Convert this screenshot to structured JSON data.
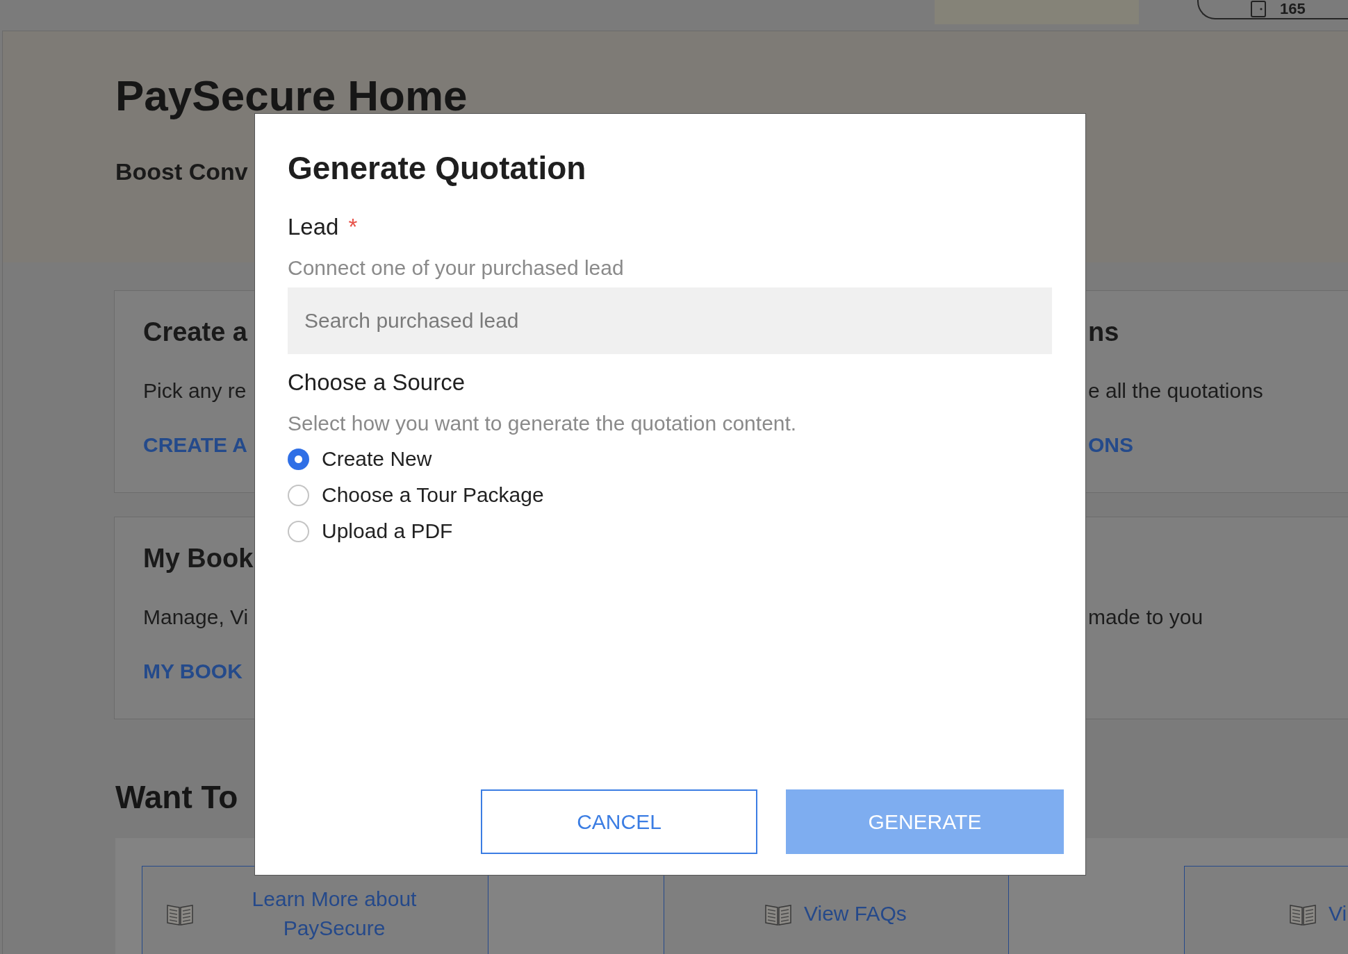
{
  "top_bar": {
    "count": "165"
  },
  "page": {
    "title": "PaySecure Home",
    "subtitle": "Boost Conv"
  },
  "card_rows": [
    {
      "cards": [
        {
          "title": "Create a",
          "text": "Pick any re",
          "link": "CREATE A"
        },
        {
          "title": "ns",
          "text": "e all the quotations",
          "link": "ONS"
        }
      ]
    },
    {
      "cards": [
        {
          "title": "My Book",
          "text": "Manage, Vi",
          "link": "MY BOOK"
        },
        {
          "text": "made to you"
        }
      ]
    }
  ],
  "section_title": "Want To",
  "resources": [
    {
      "label": "Learn More about PaySecure"
    },
    {
      "label": "View FAQs"
    },
    {
      "label": "Vi"
    }
  ],
  "dialog": {
    "title": "Generate Quotation",
    "lead": {
      "label": "Lead",
      "required_mark": "*",
      "hint": "Connect one of your purchased lead",
      "placeholder": "Search purchased lead"
    },
    "source": {
      "label": "Choose a Source",
      "hint": "Select how you want to generate the quotation content.",
      "options": [
        {
          "label": "Create New",
          "selected": true
        },
        {
          "label": "Choose a Tour Package",
          "selected": false
        },
        {
          "label": "Upload a PDF",
          "selected": false
        }
      ]
    },
    "buttons": [
      {
        "label": "CANCEL",
        "kind": "outline",
        "disabled": false
      },
      {
        "label": "GENERATE",
        "kind": "primary",
        "disabled": true
      }
    ]
  }
}
